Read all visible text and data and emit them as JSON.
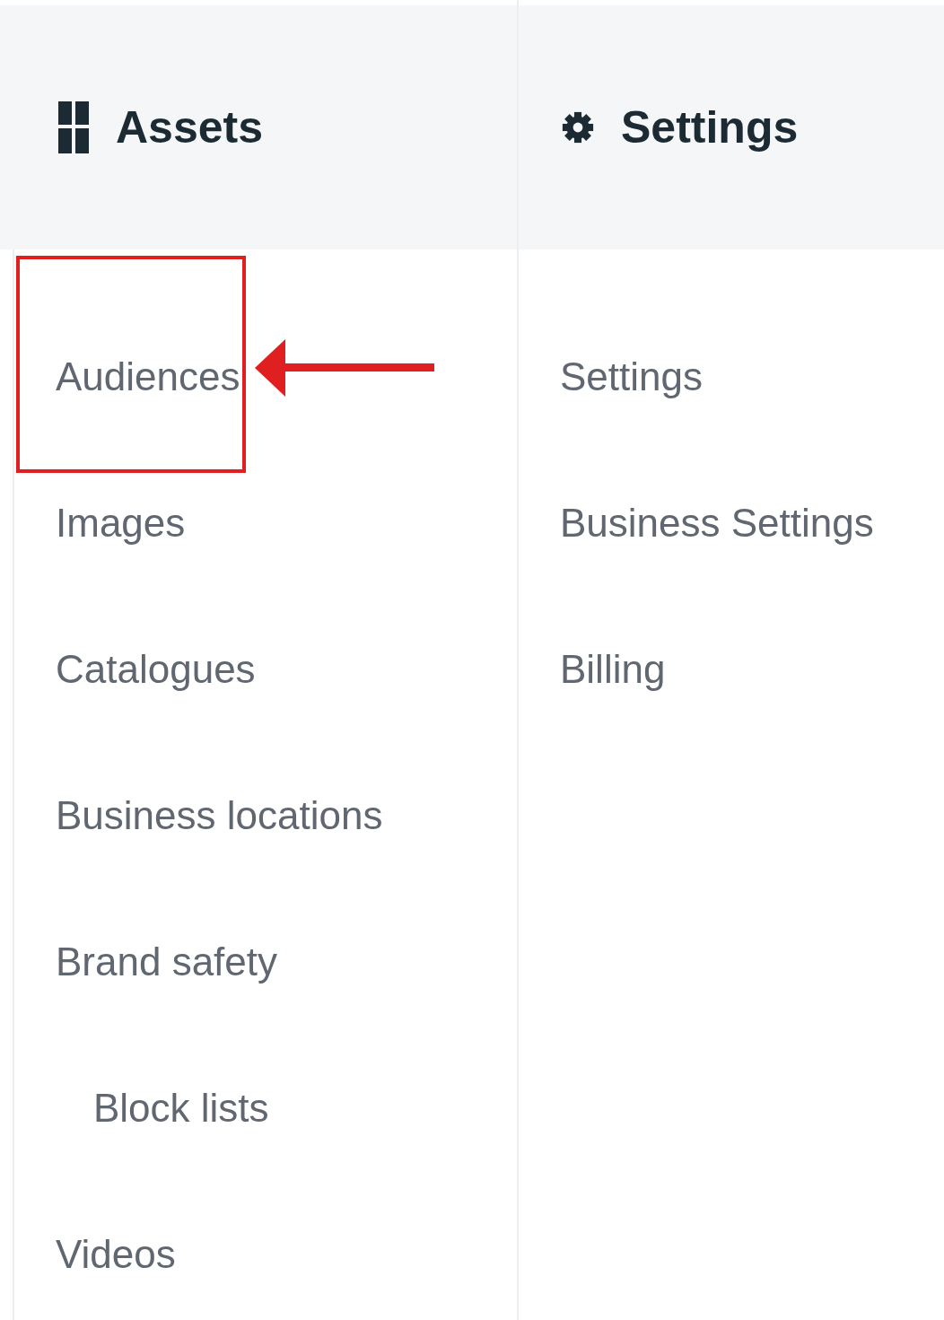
{
  "columns": [
    {
      "title": "Assets",
      "items": [
        {
          "label": "Audiences",
          "highlighted": true
        },
        {
          "label": "Images",
          "highlighted": false
        },
        {
          "label": "Catalogues",
          "highlighted": false
        },
        {
          "label": "Business locations",
          "highlighted": false
        },
        {
          "label": "Brand safety",
          "highlighted": false,
          "children": [
            {
              "label": "Block lists",
              "highlighted": false
            }
          ]
        },
        {
          "label": "Videos",
          "highlighted": false
        }
      ]
    },
    {
      "title": "Settings",
      "items": [
        {
          "label": "Settings",
          "highlighted": false
        },
        {
          "label": "Business Settings",
          "highlighted": false
        },
        {
          "label": "Billing",
          "highlighted": false
        }
      ]
    }
  ]
}
